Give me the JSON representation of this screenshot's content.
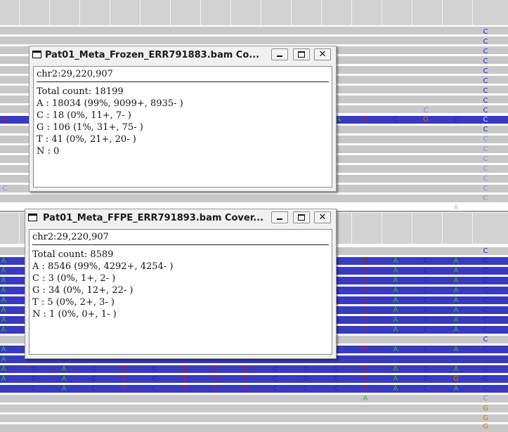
{
  "popup_frozen": {
    "title": "Pat01_Meta_Frozen_ERR791883.bam Co...",
    "locus": "chr2:29,220,907",
    "total": "Total count: 18199",
    "a": "A : 18034 (99%, 9099+, 8935- )",
    "c": "C : 18 (0%, 11+, 7- )",
    "g": "G : 106 (1%, 31+, 75- )",
    "t": "T : 41 (0%, 21+, 20- )",
    "n": "N : 0"
  },
  "popup_ffpe": {
    "title": "Pat01_Meta_FFPE_ERR791893.bam Cover...",
    "locus": "chr2:29,220,907",
    "total": "Total count: 8589",
    "a": "A : 8546 (99%, 4292+, 4254- )",
    "c": "C : 3 (0%, 1+, 2- )",
    "g": "G : 34 (0%, 12+, 22- )",
    "t": "T : 5 (0%, 2+, 3- )",
    "n": "N : 1 (0%, 0+, 1- )"
  },
  "window_buttons": {
    "minimize": "_",
    "maximize": "□",
    "close": "✕"
  },
  "colors": {
    "base_A": "#33bb33",
    "base_C": "#2222dd",
    "base_G": "#d07a00",
    "base_T": "#dd1111",
    "base_C_faint": "#8888ee",
    "read_selected": "#3a3ac0",
    "read_gray": "#c8c8c8"
  },
  "bases_top_column": [
    "C",
    "C",
    "C",
    "C",
    "C",
    "C",
    "C",
    "C",
    "C",
    "C",
    "C",
    "C",
    "C",
    "C",
    "C",
    "C",
    "C",
    "C"
  ],
  "bases_top_row": [
    "T",
    "A",
    "T",
    "C",
    "G",
    "C",
    "C"
  ],
  "bases_top_misc": [
    "C",
    "C",
    "C",
    "A",
    "C"
  ],
  "bases_bottom_left": [
    "A",
    "A",
    "A",
    "A",
    "A",
    "A",
    "A",
    "A",
    "A",
    "A",
    "A",
    "A"
  ],
  "bases_bottom_row": [
    "T",
    "A",
    "C",
    "A",
    "C"
  ],
  "bases_bottom_partial": [
    "C",
    "A",
    "C",
    "T",
    "C",
    "T",
    "T",
    "T",
    "C",
    "C",
    "C"
  ],
  "bases_bottom_low": [
    "A",
    "C",
    "G",
    "G",
    "G"
  ]
}
